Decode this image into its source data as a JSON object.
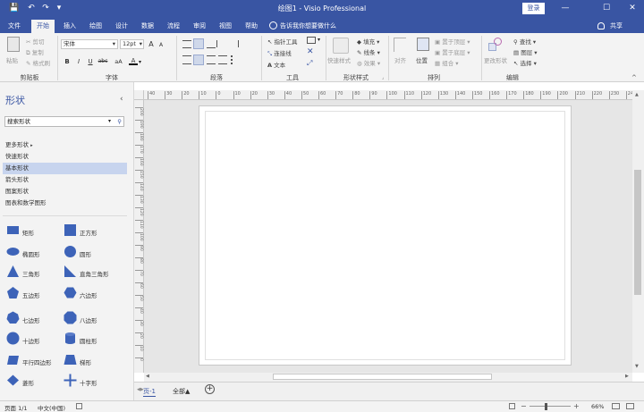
{
  "titlebar": {
    "title": "绘图1 - Visio Professional",
    "signin": "登录",
    "minimize": "—",
    "maximize": "☐",
    "close": "✕"
  },
  "quickaccess": {
    "save": "💾",
    "undo": "↶",
    "redo": "↷",
    "more": "▾"
  },
  "tabs": [
    "文件",
    "开始",
    "插入",
    "绘图",
    "设计",
    "数据",
    "流程",
    "审阅",
    "视图",
    "帮助"
  ],
  "tellme": "告诉我你想要做什么",
  "share": "共享",
  "ribbon": {
    "clipboard": {
      "label": "剪贴板",
      "paste": "粘贴",
      "cut": "剪切",
      "copy": "复制",
      "format_painter": "格式刷"
    },
    "font": {
      "label": "字体",
      "family": "宋体",
      "size": "12pt",
      "bold": "B",
      "italic": "I",
      "underline": "U",
      "strike": "abc",
      "case": "aA",
      "font_color": "A",
      "grow": "A",
      "shrink": "A",
      "clear": "A"
    },
    "paragraph": {
      "label": "段落"
    },
    "tools": {
      "label": "工具",
      "pointer": "指针工具",
      "connector": "连接线",
      "text": "文本"
    },
    "shape_styles": {
      "label": "形状样式",
      "quick_styles": "快速样式",
      "fill": "填充",
      "line": "线条",
      "effects": "效果"
    },
    "arrange": {
      "label": "排列",
      "align": "对齐",
      "position": "位置",
      "bring_front": "置于顶层",
      "send_back": "置于底层",
      "group": "组合"
    },
    "editing": {
      "label": "编辑",
      "change_shape": "更改形状",
      "find": "查找",
      "layers": "图层",
      "select": "选择"
    }
  },
  "shapes_panel": {
    "title": "形状",
    "search_placeholder": "搜索形状",
    "stencils": [
      "更多形状",
      "快速形状",
      "基本形状",
      "箭头形状",
      "图案形状",
      "图表和数学图形"
    ],
    "selected_stencil": "基本形状",
    "items": [
      {
        "label": "矩形",
        "icon": "rectangle-icon"
      },
      {
        "label": "正方形",
        "icon": "square-icon"
      },
      {
        "label": "椭圆形",
        "icon": "ellipse-icon"
      },
      {
        "label": "圆形",
        "icon": "circle-icon"
      },
      {
        "label": "三角形",
        "icon": "triangle-icon"
      },
      {
        "label": "直角三角形",
        "icon": "right-triangle-icon"
      },
      {
        "label": "五边形",
        "icon": "pentagon-icon"
      },
      {
        "label": "六边形",
        "icon": "hexagon-icon"
      },
      {
        "label": "七边形",
        "icon": "heptagon-icon"
      },
      {
        "label": "八边形",
        "icon": "octagon-icon"
      },
      {
        "label": "十边形",
        "icon": "decagon-icon"
      },
      {
        "label": "圆柱形",
        "icon": "cylinder-icon"
      },
      {
        "label": "平行四边形",
        "icon": "parallelogram-icon"
      },
      {
        "label": "梯形",
        "icon": "trapezoid-icon"
      },
      {
        "label": "菱形",
        "icon": "diamond-icon"
      },
      {
        "label": "十字形",
        "icon": "cross-icon"
      }
    ]
  },
  "ruler_top": [
    "40",
    "30",
    "20",
    "10",
    "0",
    "10",
    "20",
    "30",
    "40",
    "50",
    "60",
    "70",
    "80",
    "90",
    "100",
    "110",
    "120",
    "130",
    "140",
    "150",
    "160",
    "170",
    "180",
    "190",
    "200",
    "210",
    "220",
    "230",
    "240",
    "250"
  ],
  "ruler_left": [
    "200",
    "190",
    "180",
    "170",
    "160",
    "150",
    "140",
    "130",
    "120",
    "110",
    "100",
    "90",
    "80",
    "70",
    "60",
    "50",
    "40",
    "30",
    "20",
    "10",
    "0"
  ],
  "page_tabs": {
    "page1": "页-1",
    "all": "全部▲",
    "add": "+"
  },
  "statusbar": {
    "page": "页面 1/1",
    "language": "中文(中国)",
    "zoom": "66%"
  },
  "colors": {
    "accent": "#3955a3",
    "shape_fill": "#3d63b8"
  }
}
